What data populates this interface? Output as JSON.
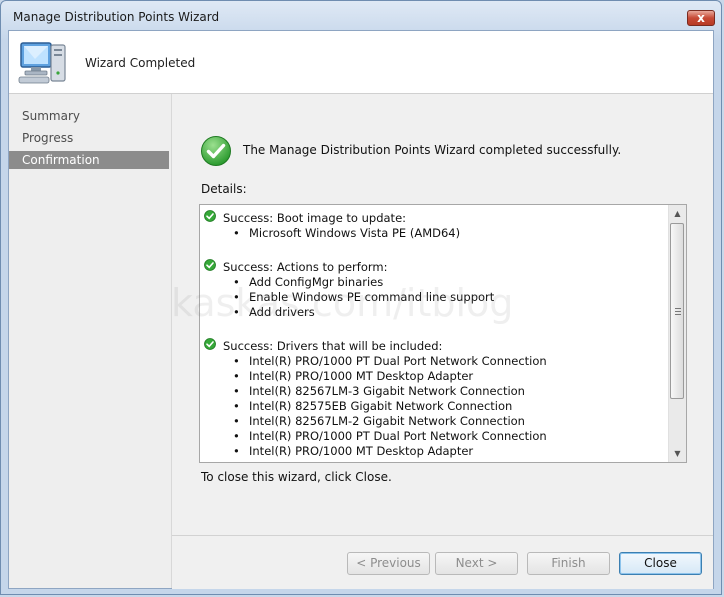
{
  "window": {
    "title": "Manage Distribution Points Wizard",
    "close_glyph": "x"
  },
  "header": {
    "title": "Wizard Completed",
    "icon": "computer-icon"
  },
  "nav": {
    "items": [
      {
        "label": "Summary"
      },
      {
        "label": "Progress"
      },
      {
        "label": "Confirmation",
        "active": true
      }
    ]
  },
  "main": {
    "success_message": "The Manage Distribution Points Wizard completed successfully.",
    "details_label": "Details:",
    "details_sections": [
      {
        "heading": "Success: Boot image to update:",
        "items": [
          "Microsoft Windows Vista PE (AMD64)"
        ]
      },
      {
        "heading": "Success: Actions to perform:",
        "items": [
          "Add ConfigMgr binaries",
          "Enable Windows PE command line support",
          "Add drivers"
        ]
      },
      {
        "heading": "Success: Drivers that will be included:",
        "items": [
          "Intel(R) PRO/1000 PT Dual Port Network Connection",
          "Intel(R) PRO/1000 MT Desktop Adapter",
          "Intel(R) 82567LM-3 Gigabit Network Connection",
          "Intel(R) 82575EB Gigabit Network Connection",
          "Intel(R) 82567LM-2 Gigabit Network Connection",
          "Intel(R) PRO/1000 PT Dual Port Network Connection",
          "Intel(R) PRO/1000 MT Desktop Adapter"
        ]
      }
    ],
    "close_hint": "To close this wizard, click Close.",
    "watermark": "kaskas.com/itblog"
  },
  "footer": {
    "previous_label": "< Previous",
    "next_label": "Next >",
    "finish_label": "Finish",
    "close_label": "Close"
  },
  "colors": {
    "success_green": "#2fa832",
    "selected_nav_bg": "#8c8c8c",
    "primary_button_border": "#3c7fb1"
  }
}
